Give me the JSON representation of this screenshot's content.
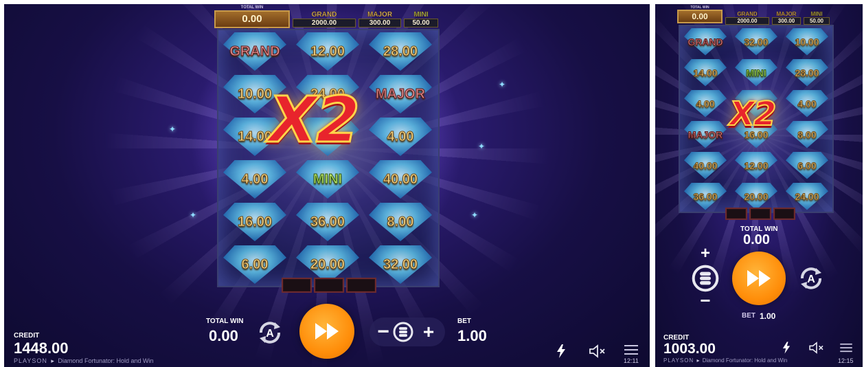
{
  "left": {
    "jackpots": {
      "total_win_label": "TOTAL WIN",
      "total_win_value": "0.00",
      "grand_label": "GRAND",
      "grand_value": "2000.00",
      "major_label": "MAJOR",
      "major_value": "300.00",
      "mini_label": "MINI",
      "mini_value": "50.00"
    },
    "grid": [
      [
        "GRAND",
        "12.00",
        "28.00"
      ],
      [
        "10.00",
        "24.00",
        "MAJOR"
      ],
      [
        "14.00",
        "",
        "4.00"
      ],
      [
        "4.00",
        "MINI",
        "40.00"
      ],
      [
        "16.00",
        "36.00",
        "8.00"
      ],
      [
        "6.00",
        "20.00",
        "32.00"
      ]
    ],
    "multiplier": "X2",
    "total_win_label": "TOTAL WIN",
    "total_win_value": "0.00",
    "bet_label": "BET",
    "bet_value": "1.00",
    "credit_label": "CREDIT",
    "credit_value": "1448.00",
    "brand": "PLAYSON",
    "game_title": "Diamond Fortunator: Hold and Win",
    "clock": "12:11"
  },
  "right": {
    "jackpots": {
      "total_win_label": "TOTAL WIN",
      "total_win_value": "0.00",
      "grand_label": "GRAND",
      "grand_value": "2000.00",
      "major_label": "MAJOR",
      "major_value": "300.00",
      "mini_label": "MINI",
      "mini_value": "50.00"
    },
    "grid": [
      [
        "GRAND",
        "32.00",
        "10.00"
      ],
      [
        "14.00",
        "MINI",
        "28.00"
      ],
      [
        "4.00",
        "",
        "4.00"
      ],
      [
        "MAJOR",
        "16.00",
        "8.00"
      ],
      [
        "40.00",
        "12.00",
        "6.00"
      ],
      [
        "36.00",
        "20.00",
        "24.00"
      ]
    ],
    "multiplier": "X2",
    "total_win_label": "TOTAL WIN",
    "total_win_value": "0.00",
    "bet_label": "BET",
    "bet_value": "1.00",
    "credit_label": "CREDIT",
    "credit_value": "1003.00",
    "brand": "PLAYSON",
    "game_title": "Diamond Fortunator: Hold and Win",
    "clock": "12:15"
  },
  "icons": {
    "autoplay": "autoplay-icon",
    "spin": "fast-forward-icon",
    "coins": "coin-stack-icon",
    "turbo": "lightning-icon",
    "sound": "speaker-muted-icon",
    "menu": "hamburger-menu-icon"
  },
  "colors": {
    "spin_button": "#ff8e0a",
    "multiplier_fill": "#e8242c",
    "multiplier_outline": "#ffd54a",
    "value_text": "#f4d88a"
  }
}
